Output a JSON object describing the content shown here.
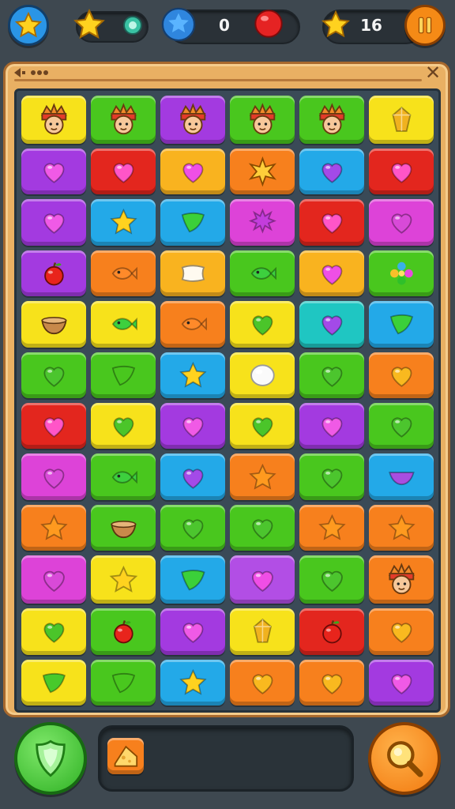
{
  "hud": {
    "left_star_button_icon": "star-icon",
    "star_count_icon": "star-icon",
    "gem_icon": "gem-icon",
    "score": "0",
    "blue_star_icon": "star-icon",
    "red_orb_icon": "red-orb-icon",
    "right_star_icon": "star-icon",
    "moves": "16",
    "pause_icon": "pause-icon"
  },
  "board": {
    "menu_icon": "menu-icon",
    "close_icon": "close-icon",
    "colors": {
      "yellow": "#f7e21b",
      "green": "#49c71e",
      "purple": "#a33ae0",
      "red": "#e3261e",
      "orange": "#f7801d",
      "blue": "#23a9e8",
      "magenta": "#dd43d8",
      "amber": "#f9b31f",
      "teal": "#1fc6c2",
      "lightpurple": "#b24ee5"
    },
    "rows": [
      [
        {
          "bg": "yellow",
          "icon": "face"
        },
        {
          "bg": "green",
          "icon": "face"
        },
        {
          "bg": "purple",
          "icon": "face"
        },
        {
          "bg": "green",
          "icon": "face"
        },
        {
          "bg": "green",
          "icon": "face"
        },
        {
          "bg": "yellow",
          "icon": "gem"
        }
      ],
      [
        {
          "bg": "purple",
          "icon": "heart"
        },
        {
          "bg": "red",
          "icon": "heart"
        },
        {
          "bg": "amber",
          "icon": "heart"
        },
        {
          "bg": "orange",
          "icon": "star-burst"
        },
        {
          "bg": "blue",
          "icon": "heart"
        },
        {
          "bg": "red",
          "icon": "heart"
        }
      ],
      [
        {
          "bg": "purple",
          "icon": "heart"
        },
        {
          "bg": "blue",
          "icon": "star"
        },
        {
          "bg": "blue",
          "icon": "leaf"
        },
        {
          "bg": "magenta",
          "icon": "splat"
        },
        {
          "bg": "red",
          "icon": "heart"
        },
        {
          "bg": "magenta",
          "icon": "heart"
        }
      ],
      [
        {
          "bg": "purple",
          "icon": "apple"
        },
        {
          "bg": "orange",
          "icon": "fish"
        },
        {
          "bg": "amber",
          "icon": "pillow"
        },
        {
          "bg": "green",
          "icon": "fish"
        },
        {
          "bg": "amber",
          "icon": "heart"
        },
        {
          "bg": "green",
          "icon": "flower"
        }
      ],
      [
        {
          "bg": "yellow",
          "icon": "bowl"
        },
        {
          "bg": "yellow",
          "icon": "fish"
        },
        {
          "bg": "orange",
          "icon": "fish"
        },
        {
          "bg": "yellow",
          "icon": "heart"
        },
        {
          "bg": "teal",
          "icon": "heart"
        },
        {
          "bg": "blue",
          "icon": "leaf"
        }
      ],
      [
        {
          "bg": "green",
          "icon": "heart"
        },
        {
          "bg": "green",
          "icon": "leaf"
        },
        {
          "bg": "blue",
          "icon": "star"
        },
        {
          "bg": "yellow",
          "icon": "orb"
        },
        {
          "bg": "green",
          "icon": "heart"
        },
        {
          "bg": "orange",
          "icon": "heart"
        }
      ],
      [
        {
          "bg": "red",
          "icon": "heart"
        },
        {
          "bg": "yellow",
          "icon": "heart"
        },
        {
          "bg": "purple",
          "icon": "heart"
        },
        {
          "bg": "yellow",
          "icon": "heart"
        },
        {
          "bg": "purple",
          "icon": "heart"
        },
        {
          "bg": "green",
          "icon": "heart"
        }
      ],
      [
        {
          "bg": "magenta",
          "icon": "heart"
        },
        {
          "bg": "green",
          "icon": "fish"
        },
        {
          "bg": "blue",
          "icon": "heart"
        },
        {
          "bg": "orange",
          "icon": "star"
        },
        {
          "bg": "green",
          "icon": "heart"
        },
        {
          "bg": "blue",
          "icon": "boat"
        }
      ],
      [
        {
          "bg": "orange",
          "icon": "star"
        },
        {
          "bg": "green",
          "icon": "bowl"
        },
        {
          "bg": "green",
          "icon": "heart"
        },
        {
          "bg": "green",
          "icon": "heart"
        },
        {
          "bg": "orange",
          "icon": "star"
        },
        {
          "bg": "orange",
          "icon": "star"
        }
      ],
      [
        {
          "bg": "magenta",
          "icon": "heart"
        },
        {
          "bg": "yellow",
          "icon": "star"
        },
        {
          "bg": "blue",
          "icon": "leaf"
        },
        {
          "bg": "lightpurple",
          "icon": "heart"
        },
        {
          "bg": "green",
          "icon": "heart"
        },
        {
          "bg": "orange",
          "icon": "face"
        }
      ],
      [
        {
          "bg": "yellow",
          "icon": "heart"
        },
        {
          "bg": "green",
          "icon": "apple"
        },
        {
          "bg": "purple",
          "icon": "heart"
        },
        {
          "bg": "yellow",
          "icon": "gem"
        },
        {
          "bg": "red",
          "icon": "apple"
        },
        {
          "bg": "orange",
          "icon": "heart"
        }
      ],
      [
        {
          "bg": "yellow",
          "icon": "leaf"
        },
        {
          "bg": "green",
          "icon": "leaf"
        },
        {
          "bg": "blue",
          "icon": "star"
        },
        {
          "bg": "orange",
          "icon": "heart"
        },
        {
          "bg": "orange",
          "icon": "heart"
        },
        {
          "bg": "purple",
          "icon": "heart"
        }
      ]
    ]
  },
  "footer": {
    "left_button_icon": "shield-icon",
    "booster_icon": "cheese-icon",
    "right_button_icon": "magnifier-icon"
  }
}
